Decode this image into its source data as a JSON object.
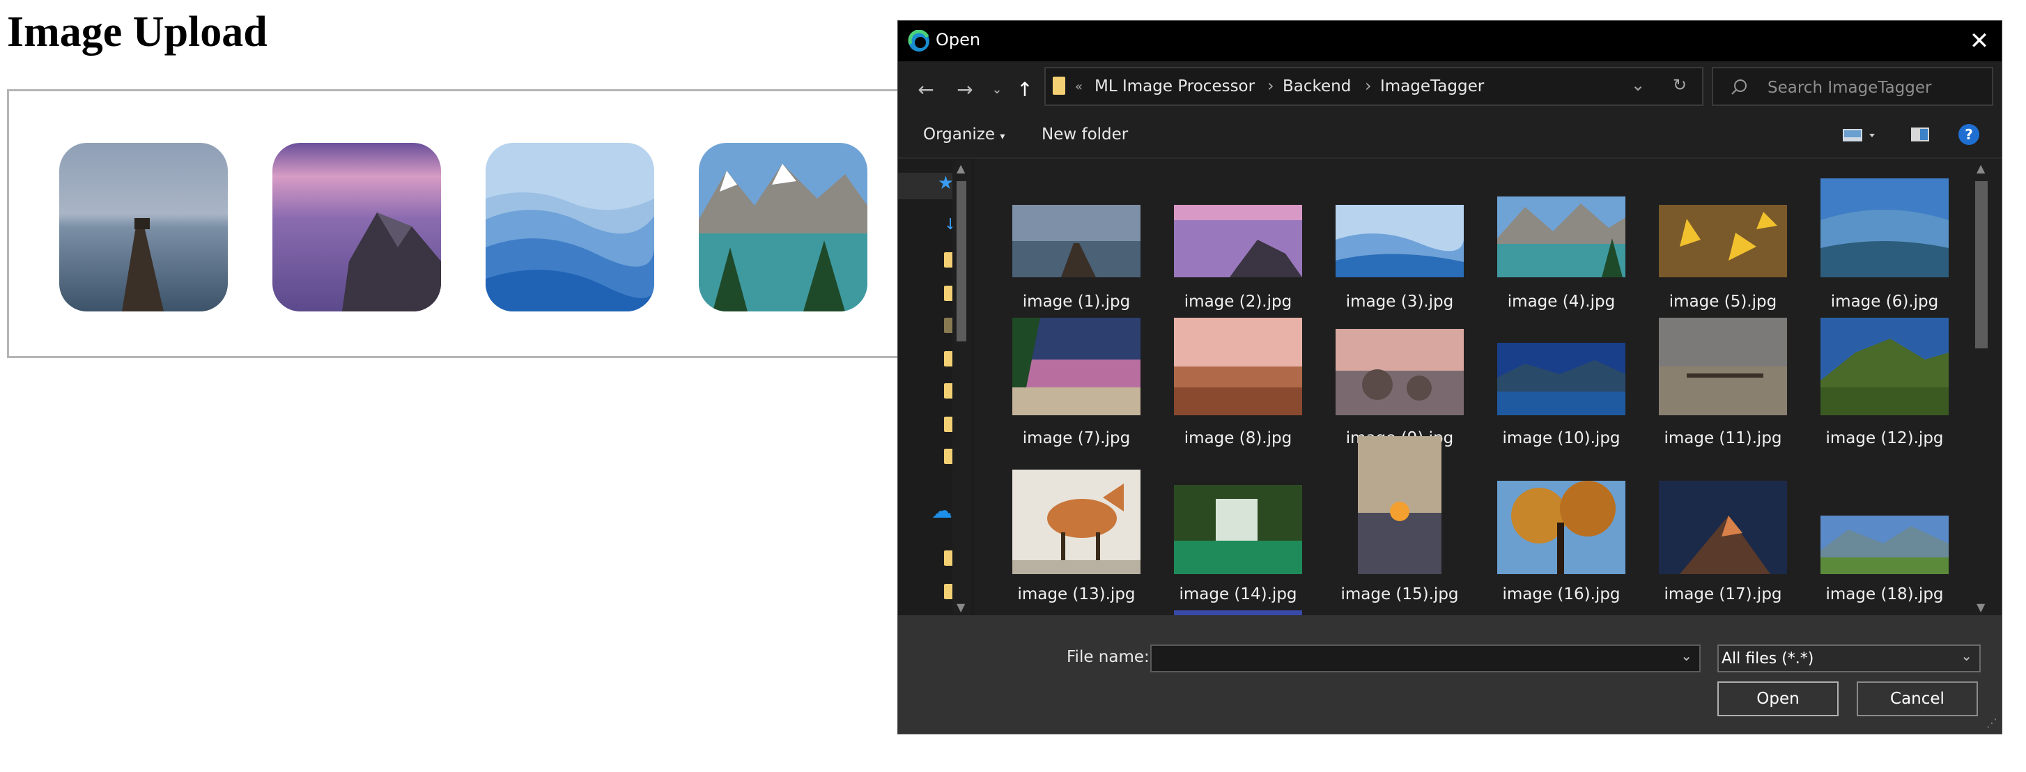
{
  "page": {
    "title": "Image Upload"
  },
  "uploads": [
    {
      "name": "uploaded-thumb-pier"
    },
    {
      "name": "uploaded-thumb-purple-rock"
    },
    {
      "name": "uploaded-thumb-blue-mountains"
    },
    {
      "name": "uploaded-thumb-lake"
    }
  ],
  "dialog": {
    "title": "Open",
    "close_icon": "close-icon",
    "nav": {
      "back_icon": "back-arrow-icon",
      "forward_icon": "forward-arrow-icon",
      "recent_icon": "chevron-down-icon",
      "up_icon": "up-arrow-icon"
    },
    "breadcrumb": [
      "ML Image Processor",
      "Backend",
      "ImageTagger"
    ],
    "breadcrumb_overflow": "«",
    "search": {
      "placeholder": "Search ImageTagger"
    },
    "toolbar": {
      "organize": "Organize",
      "new_folder": "New folder"
    },
    "files": [
      "image (1).jpg",
      "image (2).jpg",
      "image (3).jpg",
      "image (4).jpg",
      "image (5).jpg",
      "image (6).jpg",
      "image (7).jpg",
      "image (8).jpg",
      "image (9).jpg",
      "image (10).jpg",
      "image (11).jpg",
      "image (12).jpg",
      "image (13).jpg",
      "image (14).jpg",
      "image (15).jpg",
      "image (16).jpg",
      "image (17).jpg",
      "image (18).jpg"
    ],
    "file_name": {
      "label": "File name:",
      "value": ""
    },
    "file_type": {
      "selected": "All files (*.*)"
    },
    "buttons": {
      "open": "Open",
      "cancel": "Cancel"
    }
  }
}
